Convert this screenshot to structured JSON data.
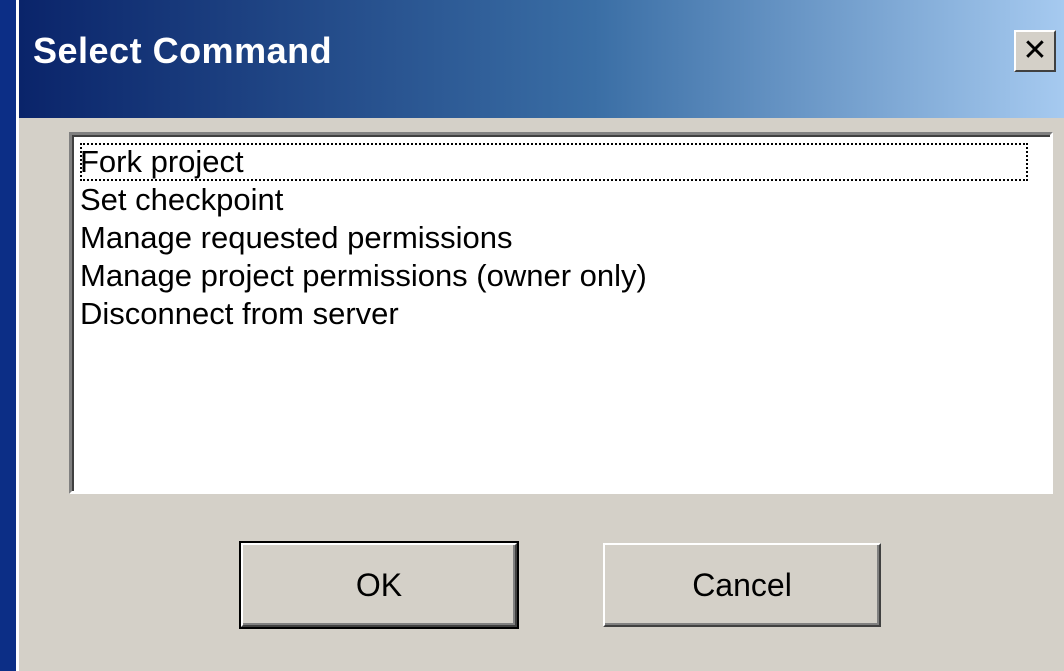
{
  "dialog": {
    "title": "Select Command",
    "close_icon": "close-icon"
  },
  "list": {
    "items": [
      "Fork project",
      "Set checkpoint",
      "Manage requested permissions",
      "Manage project permissions (owner only)",
      "Disconnect from server"
    ],
    "focused_index": 0
  },
  "buttons": {
    "ok_label": "OK",
    "cancel_label": "Cancel"
  },
  "colors": {
    "titlebar_start": "#0a246a",
    "titlebar_end": "#a6caf0",
    "dialog_face": "#d4d0c8"
  }
}
